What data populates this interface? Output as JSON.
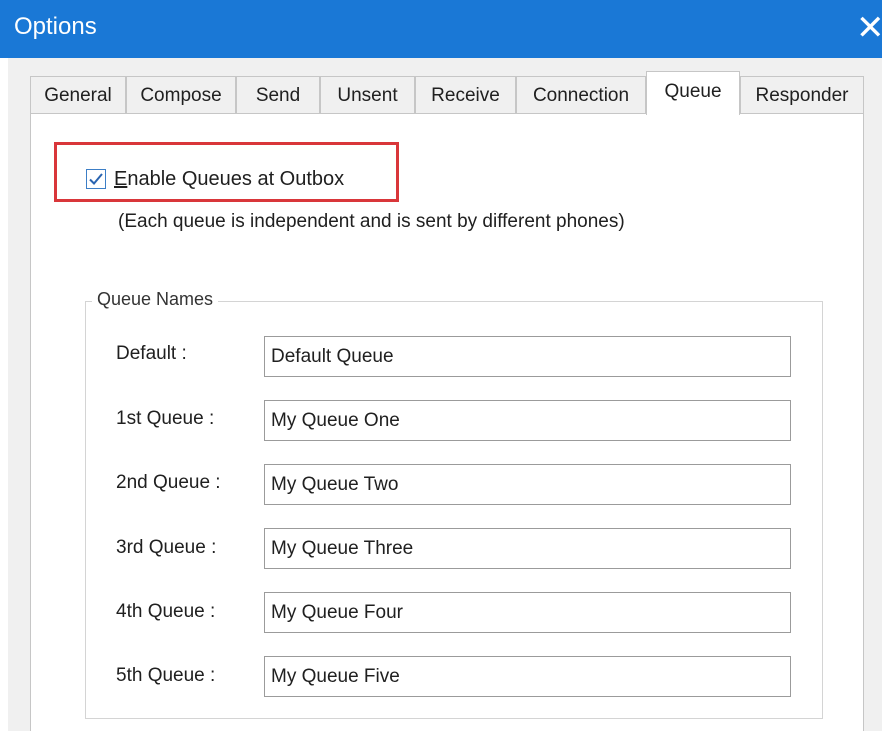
{
  "window": {
    "title": "Options",
    "close_symbol": "✕"
  },
  "tabs": [
    {
      "label": "General"
    },
    {
      "label": "Compose"
    },
    {
      "label": "Send"
    },
    {
      "label": "Unsent"
    },
    {
      "label": "Receive"
    },
    {
      "label": "Connection"
    },
    {
      "label": "Queue",
      "active": true
    },
    {
      "label": "Responder"
    }
  ],
  "queue_tab": {
    "enable_checkbox": {
      "label_first_letter": "E",
      "label_rest": "nable Queues at Outbox",
      "checked": true
    },
    "note": "(Each queue is independent and is sent by different phones)",
    "group_title": "Queue Names",
    "rows": [
      {
        "label": "Default :",
        "value": "Default Queue"
      },
      {
        "label": "1st Queue :",
        "value": "My Queue One"
      },
      {
        "label": "2nd Queue :",
        "value": "My Queue Two"
      },
      {
        "label": "3rd Queue :",
        "value": "My Queue Three"
      },
      {
        "label": "4th Queue :",
        "value": "My Queue Four"
      },
      {
        "label": "5th Queue :",
        "value": "My Queue Five"
      }
    ]
  },
  "colors": {
    "titlebar": "#1a78d6",
    "highlight_border": "#d9363a",
    "checkbox_border": "#3c7ec6"
  }
}
